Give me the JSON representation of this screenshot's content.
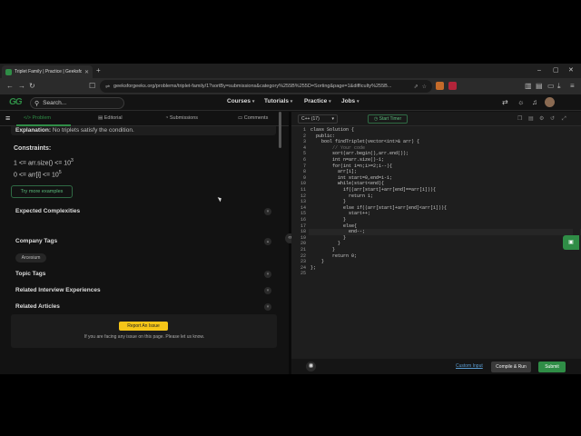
{
  "browser": {
    "tab_title": "Triplet Family | Practice | GeeksforGeeks",
    "url": "geeksforgeeks.org/problems/triplet-family/1?sortBy=submissions&category%255B%255D=Sorting&page=1&difficulty%255B..."
  },
  "header": {
    "search_placeholder": "Search...",
    "menu": [
      "Courses",
      "Tutorials",
      "Practice",
      "Jobs"
    ]
  },
  "problem_tabs": [
    "Problem",
    "Editorial",
    "Submissions",
    "Comments"
  ],
  "problem": {
    "explanation_label": "Explanation:",
    "explanation_text": "No triplets satisfy the condition.",
    "constraints_title": "Constraints:",
    "constraint_1": "1 <= arr.size() <= 10",
    "constraint_1_sup": "3",
    "constraint_2": "0 <= arr[i] <= 10",
    "constraint_2_sup": "5",
    "more_examples": "Try more examples",
    "sections": [
      "Expected Complexities",
      "Company Tags",
      "Topic Tags",
      "Related Interview Experiences",
      "Related Articles"
    ],
    "company_tags": [
      "Arcesium"
    ],
    "report_button": "Report An Issue",
    "report_note": "If you are facing any issue on this page. Please let us know."
  },
  "editor": {
    "language": "C++ (17)",
    "start_timer": "Start Timer",
    "current_line": 18,
    "code_lines": [
      "class Solution {",
      "  public:",
      "    bool findTriplet(vector<int>& arr) {",
      "        // Your code",
      "        sort(arr.begin(),arr.end());",
      "        int n=arr.size()-1;",
      "        for(int i=n;i>=2;i--){",
      "          arr[i];",
      "          int start=0,end=i-1;",
      "          while(start<end){",
      "            if((arr[start]+arr[end]==arr[i])){",
      "              return 1;",
      "            }",
      "            else if((arr[start]+arr[end]<arr[i])){",
      "              start++;",
      "            }",
      "            else{",
      "              end--;",
      "            }",
      "          }",
      "        }",
      "        return 0;",
      "    }",
      "};",
      ""
    ],
    "custom_input": "Custom Input",
    "compile_run": "Compile & Run",
    "submit": "Submit"
  },
  "colors": {
    "brand_green": "#2f8d46",
    "report_yellow": "#f5c518",
    "editor_bg": "#1e1e1e"
  }
}
